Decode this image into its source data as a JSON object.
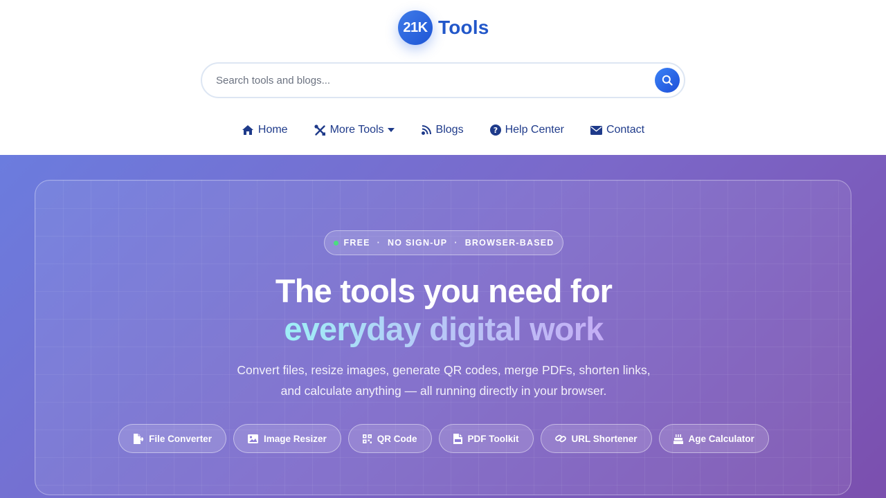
{
  "brand": {
    "logo_text": "21K",
    "name": "Tools",
    "accent_color": "#2257c9"
  },
  "search": {
    "placeholder": "Search tools and blogs...",
    "value": ""
  },
  "nav": {
    "items": [
      {
        "label": "Home",
        "icon": "home-icon"
      },
      {
        "label": "More Tools",
        "icon": "tools-icon",
        "has_dropdown": true
      },
      {
        "label": "Blogs",
        "icon": "blog-icon"
      },
      {
        "label": "Help Center",
        "icon": "question-circle-icon"
      },
      {
        "label": "Contact",
        "icon": "envelope-icon"
      }
    ]
  },
  "hero": {
    "badge": {
      "items": [
        "FREE",
        "NO SIGN-UP",
        "BROWSER-BASED"
      ],
      "separator": "·"
    },
    "headline_line1": "The tools you need for",
    "headline_line2": "everyday digital work",
    "subtext": "Convert files, resize images, generate QR codes, merge PDFs, shorten links, and calculate anything — all running directly in your browser.",
    "tools": [
      {
        "label": "File Converter",
        "icon": "file-export-icon"
      },
      {
        "label": "Image Resizer",
        "icon": "image-icon"
      },
      {
        "label": "QR Code",
        "icon": "qrcode-icon"
      },
      {
        "label": "PDF Toolkit",
        "icon": "file-pdf-icon"
      },
      {
        "label": "URL Shortener",
        "icon": "link-icon"
      },
      {
        "label": "Age Calculator",
        "icon": "birthday-cake-icon"
      }
    ],
    "colors": {
      "gradient_start": "#6b7cde",
      "gradient_end": "#7b4fae",
      "status_dot": "#4ade80"
    }
  }
}
